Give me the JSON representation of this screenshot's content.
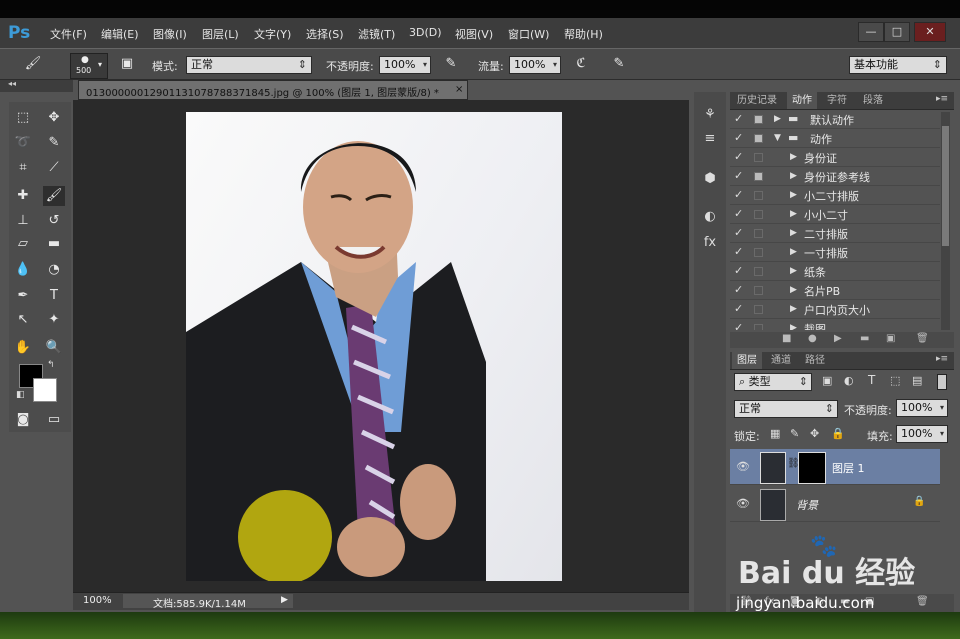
{
  "app": {
    "logo": "Ps"
  },
  "menu": [
    "文件(F)",
    "编辑(E)",
    "图像(I)",
    "图层(L)",
    "文字(Y)",
    "选择(S)",
    "滤镜(T)",
    "3D(D)",
    "视图(V)",
    "窗口(W)",
    "帮助(H)"
  ],
  "window_controls": {
    "minimize": "—",
    "restore": "□",
    "close": "✕"
  },
  "options": {
    "brush_size": "500",
    "mode_label": "模式:",
    "mode_value": "正常",
    "opacity_label": "不透明度:",
    "opacity_value": "100%",
    "flow_label": "流量:",
    "flow_value": "100%",
    "workspace": "基本功能"
  },
  "document": {
    "tab_title": "013000000129011310787883718​45.jpg @ 100% (图层 1, 图层蒙版/8) *",
    "zoom": "100%",
    "doc_info": "文档:585.9K/1.14M"
  },
  "actions_panel": {
    "tabs": [
      "历史记录",
      "动作",
      "字符",
      "段落"
    ],
    "active_tab": "动作",
    "rows": [
      {
        "label": "默认动作",
        "level": 0,
        "folder": true,
        "expanded": false
      },
      {
        "label": "动作",
        "level": 0,
        "folder": true,
        "expanded": true
      },
      {
        "label": "身份证",
        "level": 1
      },
      {
        "label": "身份证参考线",
        "level": 1
      },
      {
        "label": "小二寸排版",
        "level": 1
      },
      {
        "label": "小小二寸",
        "level": 1
      },
      {
        "label": "二寸排版",
        "level": 1
      },
      {
        "label": "一寸排版",
        "level": 1
      },
      {
        "label": "纸条",
        "level": 1
      },
      {
        "label": "名片PB",
        "level": 1
      },
      {
        "label": "户口内页大小",
        "level": 1
      },
      {
        "label": "裁图",
        "level": 1
      }
    ]
  },
  "layers_panel": {
    "tabs": [
      "图层",
      "通道",
      "路径"
    ],
    "active_tab": "图层",
    "filter_label": "类型",
    "blend_mode": "正常",
    "opacity_label": "不透明度:",
    "opacity_value": "100%",
    "lock_label": "锁定:",
    "fill_label": "填充:",
    "fill_value": "100%",
    "layers": [
      {
        "name": "图层 1",
        "selected": true
      },
      {
        "name": "背景",
        "selected": false
      }
    ]
  },
  "watermark": {
    "brand": "Bai du 经验",
    "url": "jingyan.baidu.com"
  },
  "colors": {
    "ps_blue": "#3d9bd8",
    "selected_layer": "#6b7fa3",
    "yellow_circle": "#b1a610"
  }
}
